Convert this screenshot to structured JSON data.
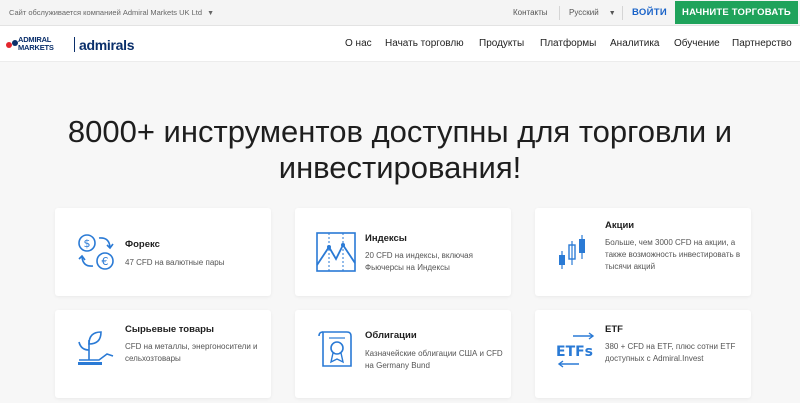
{
  "topbar": {
    "served_by": "Сайт обслуживается компанией Admiral Markets UK Ltd",
    "contacts": "Контакты",
    "language": "Русский",
    "login": "ВОЙТИ",
    "start_trading": "НАЧНИТЕ ТОРГОВАТЬ"
  },
  "logo": {
    "line1": "ADMIRAL",
    "line2": "MARKETS",
    "brand": "admirals"
  },
  "nav": {
    "items": [
      "О нас",
      "Начать торговлю",
      "Продукты",
      "Платформы",
      "Аналитика",
      "Обучение",
      "Партнерство"
    ]
  },
  "hero": {
    "headline_line1": "8000+ инструментов доступны для торговли и",
    "headline_line2": "инвестирования!"
  },
  "cards": [
    {
      "title": "Форекс",
      "desc": "47 CFD на валютные пары",
      "icon": "forex-exchange-icon"
    },
    {
      "title": "Индексы",
      "desc": "20 CFD на индексы, включая Фьючерсы на Индексы",
      "icon": "index-chart-icon"
    },
    {
      "title": "Акции",
      "desc": "Больше, чем 3000 CFD на акции, а также возможность инвестировать в тысячи акций",
      "icon": "candlestick-icon"
    },
    {
      "title": "Сырьевые товары",
      "desc": "CFD на металлы, энергоносители и сельхозтовары",
      "icon": "plant-sprout-icon"
    },
    {
      "title": "Облигации",
      "desc": "Казначейские облигации США и CFD на Germany Bund",
      "icon": "bond-certificate-icon"
    },
    {
      "title": "ETF",
      "desc": "380 + CFD на ETF, плюс сотни ETF доступных с Admiral.Invest",
      "icon": "etf-icon",
      "icon_text": "ETFs"
    }
  ],
  "colors": {
    "brand_navy": "#0a2f6b",
    "link_blue": "#1a63c8",
    "cta_green": "#1fa35b",
    "icon_blue": "#2a7ad5",
    "logo_red": "#e3262d"
  }
}
